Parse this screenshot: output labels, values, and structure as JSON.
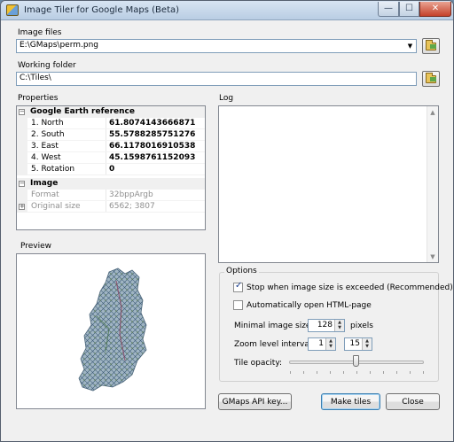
{
  "window": {
    "title": "Image Tiler for Google Maps (Beta)",
    "controls": {
      "minimize": "—",
      "maximize": "☐",
      "close": "✕"
    }
  },
  "image_files": {
    "label": "Image files",
    "value": "E:\\GMaps\\perm.png"
  },
  "working_folder": {
    "label": "Working folder",
    "value": "C:\\Tiles\\"
  },
  "properties": {
    "label": "Properties",
    "categories": [
      {
        "title": "Google Earth reference",
        "expander": "−",
        "rows": [
          {
            "name": "1. North",
            "value": "61.8074143666871"
          },
          {
            "name": "2. South",
            "value": "55.5788285751276"
          },
          {
            "name": "3. East",
            "value": "66.1178016910538"
          },
          {
            "name": "4. West",
            "value": "45.1598761152093"
          },
          {
            "name": "5. Rotation",
            "value": "0"
          }
        ]
      },
      {
        "title": "Image",
        "expander": "−",
        "rows": [
          {
            "name": "Format",
            "value": "32bppArgb"
          },
          {
            "name": "Original size",
            "value": "6562; 3807",
            "expander": "+"
          }
        ]
      }
    ]
  },
  "log": {
    "label": "Log"
  },
  "preview": {
    "label": "Preview"
  },
  "options": {
    "label": "Options",
    "stop_when_exceeded": {
      "label": "Stop when image size is exceeded (Recommended)",
      "checked": true
    },
    "auto_open_html": {
      "label": "Automatically open HTML-page",
      "checked": false
    },
    "minimal_image_size": {
      "label": "Minimal image size:",
      "value": "128",
      "unit": "pixels"
    },
    "zoom_level_interval": {
      "label": "Zoom level interval:",
      "from": "1",
      "to": "15"
    },
    "tile_opacity": {
      "label": "Tile opacity:",
      "value_fraction": 0.5
    }
  },
  "buttons": {
    "api_key": "GMaps API key...",
    "make_tiles": "Make tiles",
    "close": "Close"
  }
}
